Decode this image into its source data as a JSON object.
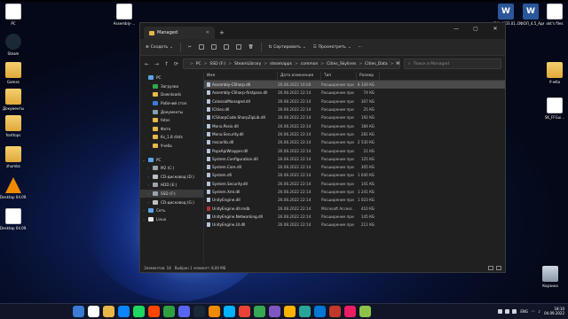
{
  "desktop": {
    "icons_left": [
      {
        "label": "PC",
        "kind": "pc"
      },
      {
        "label": "Steam",
        "kind": "steam"
      },
      {
        "label": "Games",
        "kind": "folder"
      },
      {
        "label": "Документы",
        "kind": "folder"
      },
      {
        "label": "fonttops",
        "kind": "folder"
      },
      {
        "label": "zhumbs",
        "kind": "folder"
      },
      {
        "label": "Desktop 04.09.2022...",
        "kind": "vlc"
      },
      {
        "label": "Desktop 04.09.2022...",
        "kind": "doc"
      }
    ],
    "icon_top": {
      "label": "Assembly-...",
      "kind": "doc"
    },
    "icons_right": [
      {
        "label": "ЮК-_КОЗ.01...",
        "kind": "word"
      },
      {
        "label": "ОФОЛ_4.5_Админист...",
        "kind": "word"
      },
      {
        "label": "okt's files",
        "kind": "doc"
      },
      {
        "label": "Учеба",
        "kind": "folder"
      },
      {
        "label": "SK_FFGui...",
        "kind": "doc"
      },
      {
        "label": "Корзина",
        "kind": "bin"
      }
    ]
  },
  "explorer": {
    "tab_title": "Managed",
    "toolbar": {
      "create": "Создать",
      "sort": "Сортировать",
      "view": "Просмотреть"
    },
    "path": [
      "PC",
      "SSD (F:)",
      "SteamLibrary",
      "steamapps",
      "common",
      "Cities_Skylines",
      "Cities_Data",
      "Managed"
    ],
    "search_placeholder": "Поиск в Managed",
    "columns": {
      "name": "Имя",
      "date": "Дата изменения",
      "type": "Тип",
      "size": "Размер"
    },
    "sidebar": [
      {
        "label": "PC",
        "icon": "pc",
        "indent": 0,
        "chev": ""
      },
      {
        "label": "Загрузки",
        "icon": "download",
        "indent": 1,
        "chev": ""
      },
      {
        "label": "Downloads",
        "icon": "folder",
        "indent": 1,
        "chev": ""
      },
      {
        "label": "Рабочий стол",
        "icon": "desktop",
        "indent": 1,
        "chev": ""
      },
      {
        "label": "Документы",
        "icon": "docs",
        "indent": 1,
        "chev": ""
      },
      {
        "label": "fotos",
        "icon": "folder",
        "indent": 1,
        "chev": ""
      },
      {
        "label": "Фото",
        "icon": "folder",
        "indent": 1,
        "chev": ""
      },
      {
        "label": "Ks_1.8 dists",
        "icon": "folder",
        "indent": 1,
        "chev": ""
      },
      {
        "label": "Учеба",
        "icon": "folder",
        "indent": 1,
        "chev": ""
      },
      {
        "label": "",
        "icon": "",
        "indent": 0,
        "chev": "gap"
      },
      {
        "label": "PC",
        "icon": "pc",
        "indent": 0,
        "chev": "v"
      },
      {
        "label": "M2 (C:)",
        "icon": "drive",
        "indent": 1,
        "chev": ">"
      },
      {
        "label": "CD-дисковод (D:)",
        "icon": "cd",
        "indent": 1,
        "chev": ">"
      },
      {
        "label": "HDD (E:)",
        "icon": "drive",
        "indent": 1,
        "chev": ">"
      },
      {
        "label": "SSD (F:)",
        "icon": "drive",
        "indent": 1,
        "chev": ">",
        "selected": true
      },
      {
        "label": "CD-дисковод (G:)",
        "icon": "cd",
        "indent": 1,
        "chev": ">"
      },
      {
        "label": "Сеть",
        "icon": "net",
        "indent": 0,
        "chev": ">"
      },
      {
        "label": "Linux",
        "icon": "linux",
        "indent": 0,
        "chev": ">"
      }
    ],
    "files": [
      {
        "name": "Assembly-CSharp.dll",
        "date": "26.08.2022 16:00",
        "type": "Расширение при...",
        "size": "8 339 КБ",
        "selected": true,
        "icon": "dll"
      },
      {
        "name": "Assembly-CSharp-firstpass.dll",
        "date": "26.08.2022 22:14",
        "type": "Расширение при...",
        "size": "74 КБ",
        "icon": "dll"
      },
      {
        "name": "ColossalManaged.dll",
        "date": "26.08.2022 22:14",
        "type": "Расширение при...",
        "size": "307 КБ",
        "icon": "dll"
      },
      {
        "name": "ICities.dll",
        "date": "26.08.2022 22:14",
        "type": "Расширение при...",
        "size": "25 КБ",
        "icon": "dll"
      },
      {
        "name": "ICSharpCode.SharpZipLib.dll",
        "date": "26.08.2022 22:14",
        "type": "Расширение при...",
        "size": "192 КБ",
        "icon": "dll"
      },
      {
        "name": "Mono.Posix.dll",
        "date": "26.08.2022 22:14",
        "type": "Расширение при...",
        "size": "184 КБ",
        "icon": "dll"
      },
      {
        "name": "Mono.Security.dll",
        "date": "26.08.2022 22:14",
        "type": "Расширение при...",
        "size": "281 КБ",
        "icon": "dll"
      },
      {
        "name": "mscorlib.dll",
        "date": "26.08.2022 22:14",
        "type": "Расширение при...",
        "size": "2 530 КБ",
        "icon": "dll"
      },
      {
        "name": "PopsApiWrapper.dll",
        "date": "26.08.2022 22:14",
        "type": "Расширение при...",
        "size": "21 КБ",
        "icon": "dll"
      },
      {
        "name": "System.Configuration.dll",
        "date": "26.08.2022 22:14",
        "type": "Расширение при...",
        "size": "125 КБ",
        "icon": "dll"
      },
      {
        "name": "System.Core.dll",
        "date": "26.08.2022 22:14",
        "type": "Расширение при...",
        "size": "305 КБ",
        "icon": "dll"
      },
      {
        "name": "System.dll",
        "date": "26.08.2022 22:14",
        "type": "Расширение при...",
        "size": "1 640 КБ",
        "icon": "dll"
      },
      {
        "name": "System.Security.dll",
        "date": "26.08.2022 22:14",
        "type": "Расширение при...",
        "size": "141 КБ",
        "icon": "dll"
      },
      {
        "name": "System.Xml.dll",
        "date": "26.08.2022 22:14",
        "type": "Расширение при...",
        "size": "1 241 КБ",
        "icon": "dll"
      },
      {
        "name": "UnityEngine.dll",
        "date": "26.08.2022 22:14",
        "type": "Расширение при...",
        "size": "1 023 КБ",
        "icon": "dll"
      },
      {
        "name": "UnityEngine.dll.mdb",
        "date": "26.08.2022 22:14",
        "type": "Microsoft Access ...",
        "size": "410 КБ",
        "icon": "mdb"
      },
      {
        "name": "UnityEngine.Networking.dll",
        "date": "26.08.2022 22:14",
        "type": "Расширение при...",
        "size": "145 КБ",
        "icon": "dll"
      },
      {
        "name": "UnityEngine.UI.dll",
        "date": "26.08.2022 22:14",
        "type": "Расширение при...",
        "size": "211 КБ",
        "icon": "dll"
      }
    ],
    "status": {
      "count": "Элементов: 18",
      "selection": "Выбран 1 элемент: 8,00 МБ"
    }
  },
  "taskbar": {
    "lang": "ENG",
    "time": "18:10",
    "date": "04.09.2022",
    "apps": [
      "#3a7bd5",
      "#ffffff",
      "#e8b74a",
      "#0a84ff",
      "#1ed760",
      "#ff4500",
      "#2ea043",
      "#5865f2",
      "#1b2838",
      "#f08a00",
      "#00b2ff",
      "#ea4335",
      "#34a853",
      "#7e57c2",
      "#ffb300",
      "#26a69a",
      "#0078d4",
      "#c0392b",
      "#e91e63",
      "#8bc34a"
    ]
  },
  "colors": {
    "accent": "#4a4a4a",
    "folder": "#e8b74a",
    "window_bg": "#202020"
  }
}
